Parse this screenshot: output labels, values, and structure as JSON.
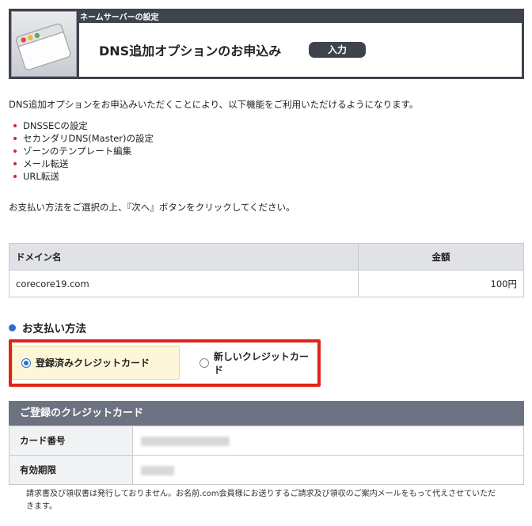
{
  "header": {
    "subtitle": "ネームサーバーの設定",
    "title": "DNS追加オプションのお申込み",
    "step_label": "入力",
    "icon": "browser-window-icon"
  },
  "intro": "DNS追加オプションをお申込みいただくことにより、以下機能をご利用いただけるようになります。",
  "features": [
    "DNSSECの設定",
    "セカンダリDNS(Master)の設定",
    "ゾーンのテンプレート編集",
    "メール転送",
    "URL転送"
  ],
  "instruction": "お支払い方法をご選択の上、『次へ』ボタンをクリックしてください。",
  "domain_table": {
    "headers": {
      "domain": "ドメイン名",
      "amount": "金額"
    },
    "rows": [
      {
        "domain": "corecore19.com",
        "amount": "100円"
      }
    ]
  },
  "payment": {
    "heading": "お支払い方法",
    "options": [
      {
        "label": "登録済みクレジットカード",
        "selected": true
      },
      {
        "label": "新しいクレジットカード",
        "selected": false
      }
    ],
    "highlight_color": "#e02319"
  },
  "registered_card": {
    "heading": "ご登録のクレジットカード",
    "rows": [
      {
        "label": "カード番号"
      },
      {
        "label": "有効期限"
      }
    ]
  },
  "note": "請求書及び領収書は発行しておりません。お名前.com会員様にお送りするご請求及び領収のご案内メールをもって代えさせていただきます。",
  "colors": {
    "header_bg": "#3e434c",
    "accent_blue": "#2a6fcf",
    "bullet_red": "#d0272a",
    "selected_bg": "#fdf6d8"
  }
}
